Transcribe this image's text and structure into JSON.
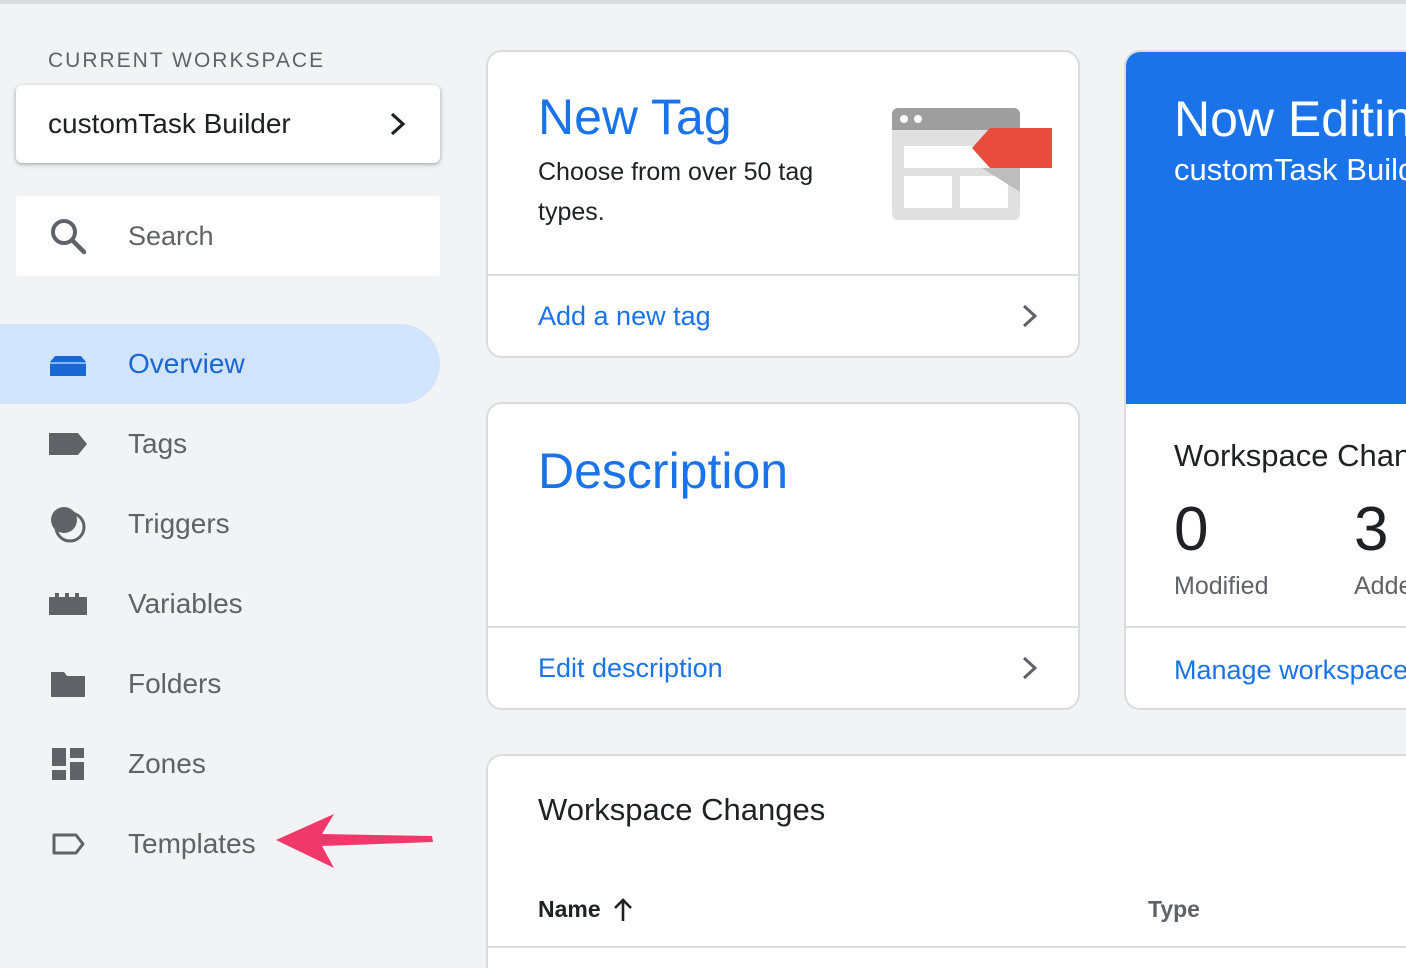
{
  "sidebar": {
    "workspace_label": "CURRENT WORKSPACE",
    "workspace_name": "customTask Builder",
    "search_placeholder": "Search",
    "nav": [
      {
        "label": "Overview",
        "icon": "overview-icon",
        "active": true
      },
      {
        "label": "Tags",
        "icon": "tag-icon"
      },
      {
        "label": "Triggers",
        "icon": "trigger-icon"
      },
      {
        "label": "Variables",
        "icon": "variables-icon"
      },
      {
        "label": "Folders",
        "icon": "folder-icon"
      },
      {
        "label": "Zones",
        "icon": "zones-icon"
      },
      {
        "label": "Templates",
        "icon": "templates-icon"
      }
    ]
  },
  "new_tag_card": {
    "title": "New Tag",
    "subtitle": "Choose from over 50 tag types.",
    "link": "Add a new tag"
  },
  "description_card": {
    "title": "Description",
    "link": "Edit description"
  },
  "editing_card": {
    "title": "Now Editing",
    "subtitle": "customTask Builder",
    "changes_title": "Workspace Changes",
    "modified_count": "0",
    "modified_label": "Modified",
    "added_count": "3",
    "added_label": "Added",
    "link": "Manage workspaces"
  },
  "changes_table": {
    "title": "Workspace Changes",
    "columns": {
      "name": "Name",
      "type": "Type"
    }
  },
  "colors": {
    "accent": "#1a73e8",
    "active_bg": "#d2e3fc",
    "annotation_arrow": "#f0386b",
    "tag_red": "#e94b3c"
  }
}
